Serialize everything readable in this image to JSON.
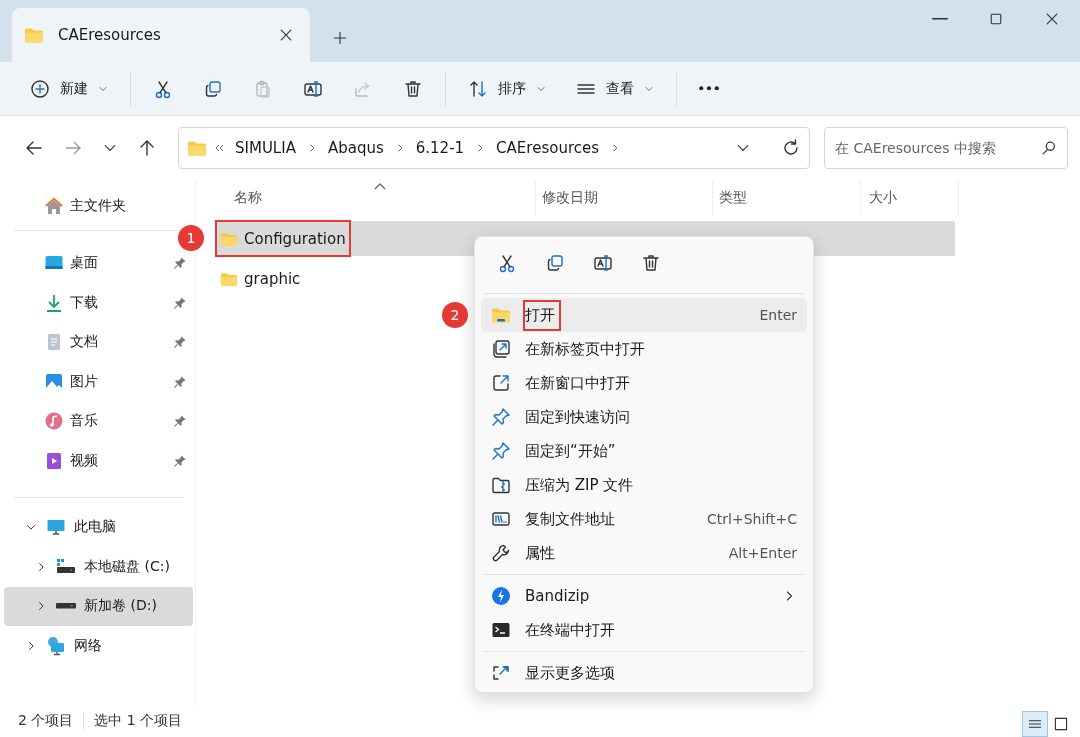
{
  "tab": {
    "title": "CAEresources"
  },
  "toolbar": [
    {
      "kind": "new",
      "label": "新建",
      "disabled": false
    },
    {
      "kind": "cut",
      "disabled": false
    },
    {
      "kind": "copy",
      "disabled": false
    },
    {
      "kind": "paste",
      "disabled": true
    },
    {
      "kind": "rename",
      "disabled": false
    },
    {
      "kind": "share",
      "disabled": true
    },
    {
      "kind": "delete",
      "disabled": false
    },
    {
      "kind": "sort",
      "label": "排序",
      "disabled": false
    },
    {
      "kind": "view",
      "label": "查看",
      "disabled": false
    },
    {
      "kind": "more",
      "disabled": false
    }
  ],
  "breadcrumbs": [
    "SIMULIA",
    "Abaqus",
    "6.12-1",
    "CAEresources"
  ],
  "search": {
    "placeholder": "在 CAEresources 中搜索"
  },
  "sidebar": [
    {
      "kind": "home",
      "label": "主文件夹",
      "pinned": false
    },
    {
      "kind": "desktop",
      "label": "桌面",
      "pinned": true
    },
    {
      "kind": "download",
      "label": "下载",
      "pinned": true
    },
    {
      "kind": "docs",
      "label": "文档",
      "pinned": true
    },
    {
      "kind": "pictures",
      "label": "图片",
      "pinned": true
    },
    {
      "kind": "music",
      "label": "音乐",
      "pinned": true
    },
    {
      "kind": "video",
      "label": "视频",
      "pinned": true
    }
  ],
  "tree": [
    {
      "kind": "pc",
      "label": "此电脑",
      "expanded": true,
      "selected": false,
      "children": [
        {
          "kind": "cdrive",
          "label": "本地磁盘 (C:)",
          "expanded": false,
          "selected": false
        },
        {
          "kind": "drive",
          "label": "新加卷 (D:)",
          "expanded": false,
          "selected": true
        }
      ]
    },
    {
      "kind": "network",
      "label": "网络",
      "expanded": false,
      "selected": false
    }
  ],
  "columns": [
    {
      "label": "名称",
      "sorted": true
    },
    {
      "label": "修改日期",
      "sorted": false
    },
    {
      "label": "类型",
      "sorted": false
    },
    {
      "label": "大小",
      "sorted": false
    }
  ],
  "files": [
    {
      "name": "Configuration",
      "selected": true,
      "marker": "1"
    },
    {
      "name": "graphic",
      "selected": false
    }
  ],
  "status_bar": {
    "count": "2 个项目",
    "selection": "选中 1 个项目"
  },
  "view_buttons": [
    {
      "kind": "details",
      "selected": true
    },
    {
      "kind": "tiles",
      "selected": false
    }
  ],
  "context_menu": {
    "quick_actions": [
      {
        "kind": "cut"
      },
      {
        "kind": "copy"
      },
      {
        "kind": "rename"
      },
      {
        "kind": "delete"
      }
    ],
    "groups": [
      [
        {
          "kind": "folder",
          "label": "打开",
          "shortcut": "Enter",
          "selected": true,
          "marker": "2"
        },
        {
          "kind": "newtab",
          "label": "在新标签页中打开",
          "selected": false
        },
        {
          "kind": "newwin",
          "label": "在新窗口中打开",
          "selected": false
        },
        {
          "kind": "pin",
          "label": "固定到快速访问",
          "selected": false
        },
        {
          "kind": "pin",
          "label": "固定到“开始”",
          "selected": false
        },
        {
          "kind": "zip",
          "label": "压缩为 ZIP 文件",
          "selected": false
        },
        {
          "kind": "path",
          "label": "复制文件地址",
          "shortcut": "Ctrl+Shift+C",
          "selected": false
        },
        {
          "kind": "wrench",
          "label": "属性",
          "shortcut": "Alt+Enter",
          "selected": false
        }
      ],
      [
        {
          "kind": "bandizip",
          "label": "Bandizip",
          "submenu": true,
          "selected": false
        },
        {
          "kind": "terminal",
          "label": "在终端中打开",
          "selected": false
        }
      ],
      [
        {
          "kind": "more",
          "label": "显示更多选项",
          "selected": false
        }
      ]
    ]
  }
}
